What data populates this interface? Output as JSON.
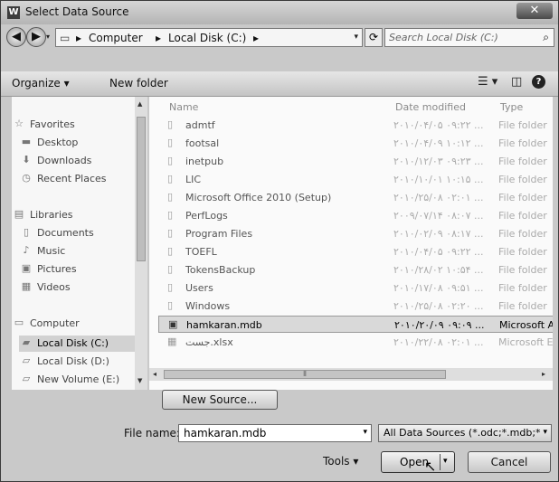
{
  "window": {
    "title": "Select Data Source",
    "icon_letter": "W",
    "close_glyph": "✕"
  },
  "address": {
    "back_glyph": "◀",
    "forward_glyph": "▶",
    "breadcrumbs": [
      "Computer",
      "Local Disk (C:)"
    ],
    "separator": "▸",
    "refresh_glyph": "⟳",
    "search_placeholder": "Search Local Disk (C:)",
    "search_glyph": "⌕"
  },
  "toolbar": {
    "organize": "Organize ▾",
    "new_folder": "New folder",
    "view_glyph": "☰ ▾",
    "pane_glyph": "◫",
    "help_glyph": "?"
  },
  "nav": [
    {
      "label": "Favorites",
      "icon": "☆",
      "name": "nav-favorites",
      "sub": false
    },
    {
      "label": "Desktop",
      "icon": "▬",
      "name": "nav-desktop",
      "sub": true
    },
    {
      "label": "Downloads",
      "icon": "⬇",
      "name": "nav-downloads",
      "sub": true
    },
    {
      "label": "Recent Places",
      "icon": "◷",
      "name": "nav-recent-places",
      "sub": true
    },
    {
      "label": "Libraries",
      "icon": "▤",
      "name": "nav-libraries",
      "sub": false
    },
    {
      "label": "Documents",
      "icon": "▯",
      "name": "nav-documents",
      "sub": true
    },
    {
      "label": "Music",
      "icon": "♪",
      "name": "nav-music",
      "sub": true
    },
    {
      "label": "Pictures",
      "icon": "▣",
      "name": "nav-pictures",
      "sub": true
    },
    {
      "label": "Videos",
      "icon": "▦",
      "name": "nav-videos",
      "sub": true
    },
    {
      "label": "Computer",
      "icon": "▭",
      "name": "nav-computer",
      "sub": false
    },
    {
      "label": "Local Disk (C:)",
      "icon": "▰",
      "name": "nav-local-disk-c",
      "sub": true,
      "selected": true
    },
    {
      "label": "Local Disk (D:)",
      "icon": "▱",
      "name": "nav-local-disk-d",
      "sub": true
    },
    {
      "label": "New Volume (E:)",
      "icon": "▱",
      "name": "nav-new-volume-e",
      "sub": true
    }
  ],
  "columns": {
    "name": "Name",
    "date": "Date modified",
    "type": "Type"
  },
  "files": [
    {
      "name": "admtf",
      "date": "۲۰۱۰/۰۴/۰۵ ۰۹:۲۲ ...",
      "type": "File folder"
    },
    {
      "name": "footsal",
      "date": "۲۰۱۰/۰۴/۰۹ ۱۰:۱۲ ...",
      "type": "File folder"
    },
    {
      "name": "inetpub",
      "date": "۲۰۱۰/۱۲/۰۳ ۰۹:۲۳ ...",
      "type": "File folder"
    },
    {
      "name": "LIC",
      "date": "۲۰۱۰/۱۰/۰۱ ۱۰:۱۵ ...",
      "type": "File folder"
    },
    {
      "name": "Microsoft Office 2010 (Setup)",
      "date": "۲۰۱۰/۲۵/۰۸ ۰۲:۰۱ ...",
      "type": "File folder"
    },
    {
      "name": "PerfLogs",
      "date": "۲۰۰۹/۰۷/۱۴ ۰۸:۰۷ ...",
      "type": "File folder"
    },
    {
      "name": "Program Files",
      "date": "۲۰۱۰/۰۲/۰۹ ۰۸:۱۷ ...",
      "type": "File folder"
    },
    {
      "name": "TOEFL",
      "date": "۲۰۱۰/۰۴/۰۵ ۰۹:۲۲ ...",
      "type": "File folder"
    },
    {
      "name": "TokensBackup",
      "date": "۲۰۱۰/۲۸/۰۲ ۱۰:۵۴ ...",
      "type": "File folder"
    },
    {
      "name": "Users",
      "date": "۲۰۱۰/۱۷/۰۸ ۰۹:۵۱ ...",
      "type": "File folder"
    },
    {
      "name": "Windows",
      "date": "۲۰۱۰/۲۵/۰۸ ۰۲:۲۰ ...",
      "type": "File folder"
    },
    {
      "name": "hamkaran.mdb",
      "date": "۲۰۱۰/۲۰/۰۹ ۰۹:۰۹ ...",
      "type": "Microsoft Ac",
      "selected": true,
      "icon": "▣"
    },
    {
      "name": "جست.xlsx",
      "date": "۲۰۱۰/۲۲/۰۸ ۰۲:۰۱ ...",
      "type": "Microsoft Ex",
      "icon": "▦"
    }
  ],
  "hscroll": {
    "thumb_glyph": "⦀",
    "left_glyph": "◂",
    "right_glyph": "▸"
  },
  "buttons": {
    "new_source": "New Source...",
    "tools": "Tools ▾",
    "open": "Open",
    "open_dropdown": "▾",
    "cancel": "Cancel"
  },
  "filename": {
    "label": "File name:",
    "value": "hamkaran.mdb",
    "dropdown": "▾"
  },
  "filetype": {
    "value": "All Data Sources (*.odc;*.mdb;*",
    "dropdown": "▾"
  },
  "cursor_glyph": "↖"
}
